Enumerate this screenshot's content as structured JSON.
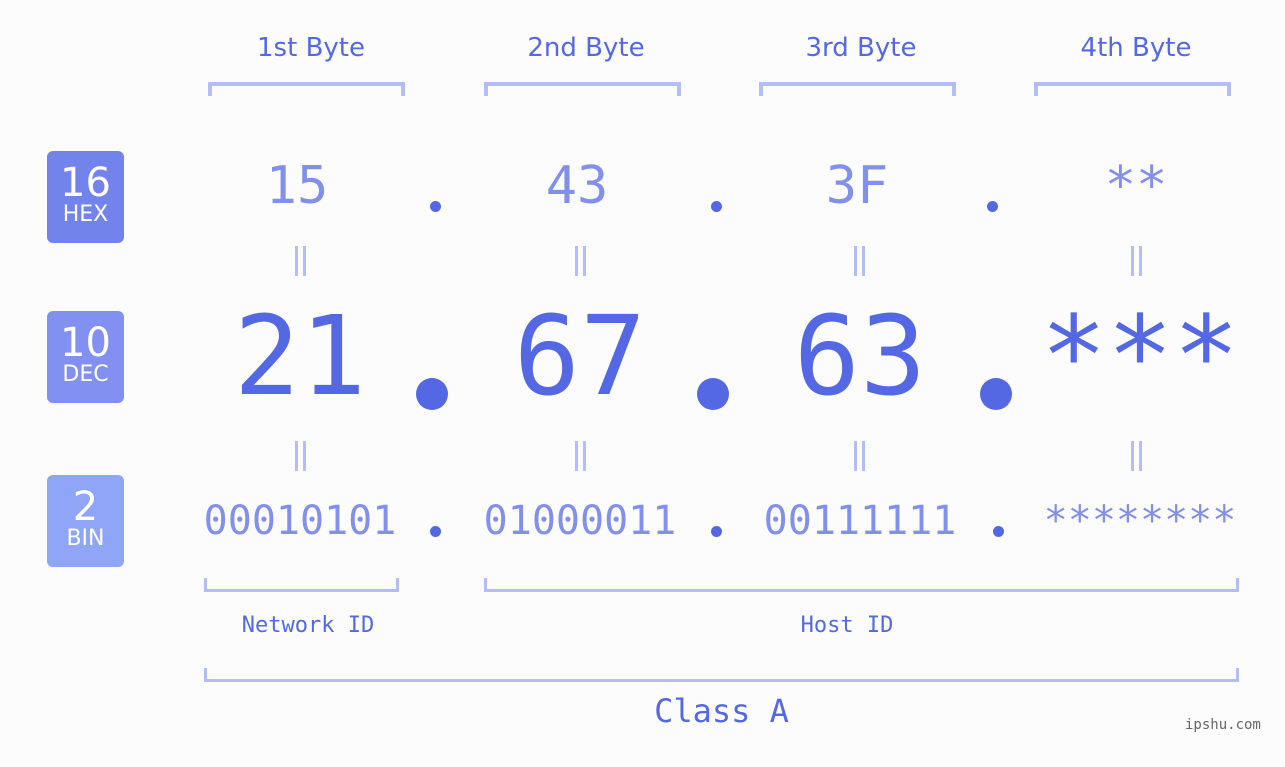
{
  "headers": [
    "1st Byte",
    "2nd Byte",
    "3rd Byte",
    "4th Byte"
  ],
  "badges": [
    {
      "num": "16",
      "label": "HEX",
      "color": "#7383ec"
    },
    {
      "num": "10",
      "label": "DEC",
      "color": "#8290f2"
    },
    {
      "num": "2",
      "label": "BIN",
      "color": "#8fa5f8"
    }
  ],
  "hex": [
    "15",
    "43",
    "3F",
    "**"
  ],
  "dec": [
    "21",
    "67",
    "63",
    "***"
  ],
  "bin": [
    "00010101",
    "01000011",
    "00111111",
    "********"
  ],
  "network_id_label": "Network ID",
  "host_id_label": "Host ID",
  "class_label": "Class A",
  "watermark": "ipshu.com"
}
